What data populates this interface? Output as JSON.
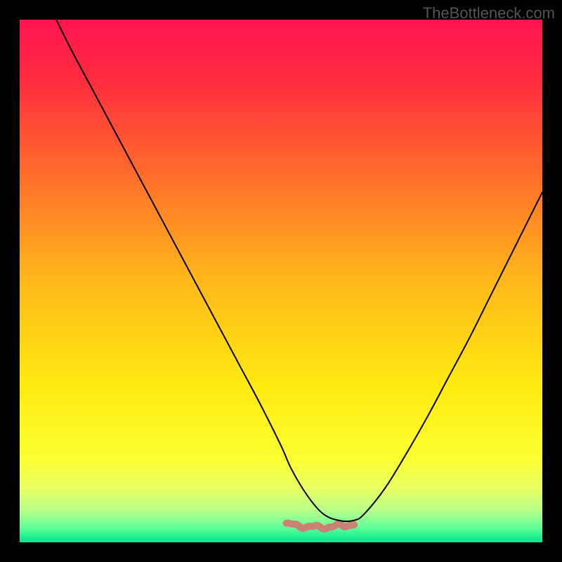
{
  "watermark": "TheBottleneck.com",
  "chart_data": {
    "type": "line",
    "title": "",
    "xlabel": "",
    "ylabel": "",
    "xlim": [
      0,
      100
    ],
    "ylim": [
      0,
      100
    ],
    "grid": false,
    "legend": false,
    "background_gradient": {
      "stops": [
        {
          "offset": 0.0,
          "color": "#ff1450"
        },
        {
          "offset": 0.12,
          "color": "#ff2d3e"
        },
        {
          "offset": 0.3,
          "color": "#ff6e2a"
        },
        {
          "offset": 0.5,
          "color": "#ffb81a"
        },
        {
          "offset": 0.7,
          "color": "#ffea10"
        },
        {
          "offset": 0.84,
          "color": "#fbff30"
        },
        {
          "offset": 0.9,
          "color": "#e6ff66"
        },
        {
          "offset": 0.94,
          "color": "#b6ff8a"
        },
        {
          "offset": 0.97,
          "color": "#66ff99"
        },
        {
          "offset": 1.0,
          "color": "#00e68c"
        }
      ]
    },
    "marker_band": {
      "x_start": 51,
      "x_end": 64,
      "y": 3.5,
      "color": "#d07a72",
      "amplitude": 0.6
    },
    "series": [
      {
        "name": "main-curve",
        "color": "#000000",
        "stroke_width": 2,
        "x": [
          7,
          10,
          14,
          18,
          22,
          26,
          30,
          34,
          38,
          42,
          46,
          50,
          52,
          55,
          58,
          61,
          64,
          66,
          70,
          74,
          78,
          82,
          86,
          90,
          94,
          98,
          100
        ],
        "y": [
          100,
          94,
          86.5,
          79,
          71.5,
          64,
          56.5,
          49,
          41.5,
          34,
          26.5,
          18.5,
          14,
          9,
          5.5,
          4.2,
          4.2,
          5.5,
          10.5,
          17,
          24,
          31.5,
          39,
          47,
          55,
          63,
          67
        ]
      }
    ]
  }
}
